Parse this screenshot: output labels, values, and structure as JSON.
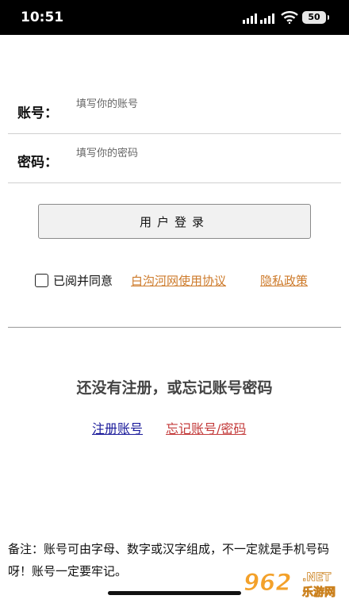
{
  "status_bar": {
    "time": "10:51",
    "battery": "50"
  },
  "form": {
    "account_label": "账号：",
    "account_placeholder": "填写你的账号",
    "password_label": "密码：",
    "password_placeholder": "填写你的密码",
    "login_button": "用户登录"
  },
  "agreement": {
    "text": "已阅并同意",
    "terms_link": "白沟河网使用协议",
    "privacy_link": "隐私政策",
    "checked": false
  },
  "help": {
    "prompt": "还没有注册，或忘记账号密码",
    "register_link": "注册账号",
    "forgot_link": "忘记账号/密码"
  },
  "note": "备注：账号可由字母、数字或汉字组成，不一定就是手机号码呀！账号一定要牢记。",
  "watermark": {
    "logo": "962",
    "suffix": ".NET",
    "label": "乐游网"
  },
  "colors": {
    "link_orange": "#cd7a2a",
    "link_blue": "#1a1a9a",
    "link_red": "#c33a3a",
    "watermark_orange": "#f39c1f"
  }
}
